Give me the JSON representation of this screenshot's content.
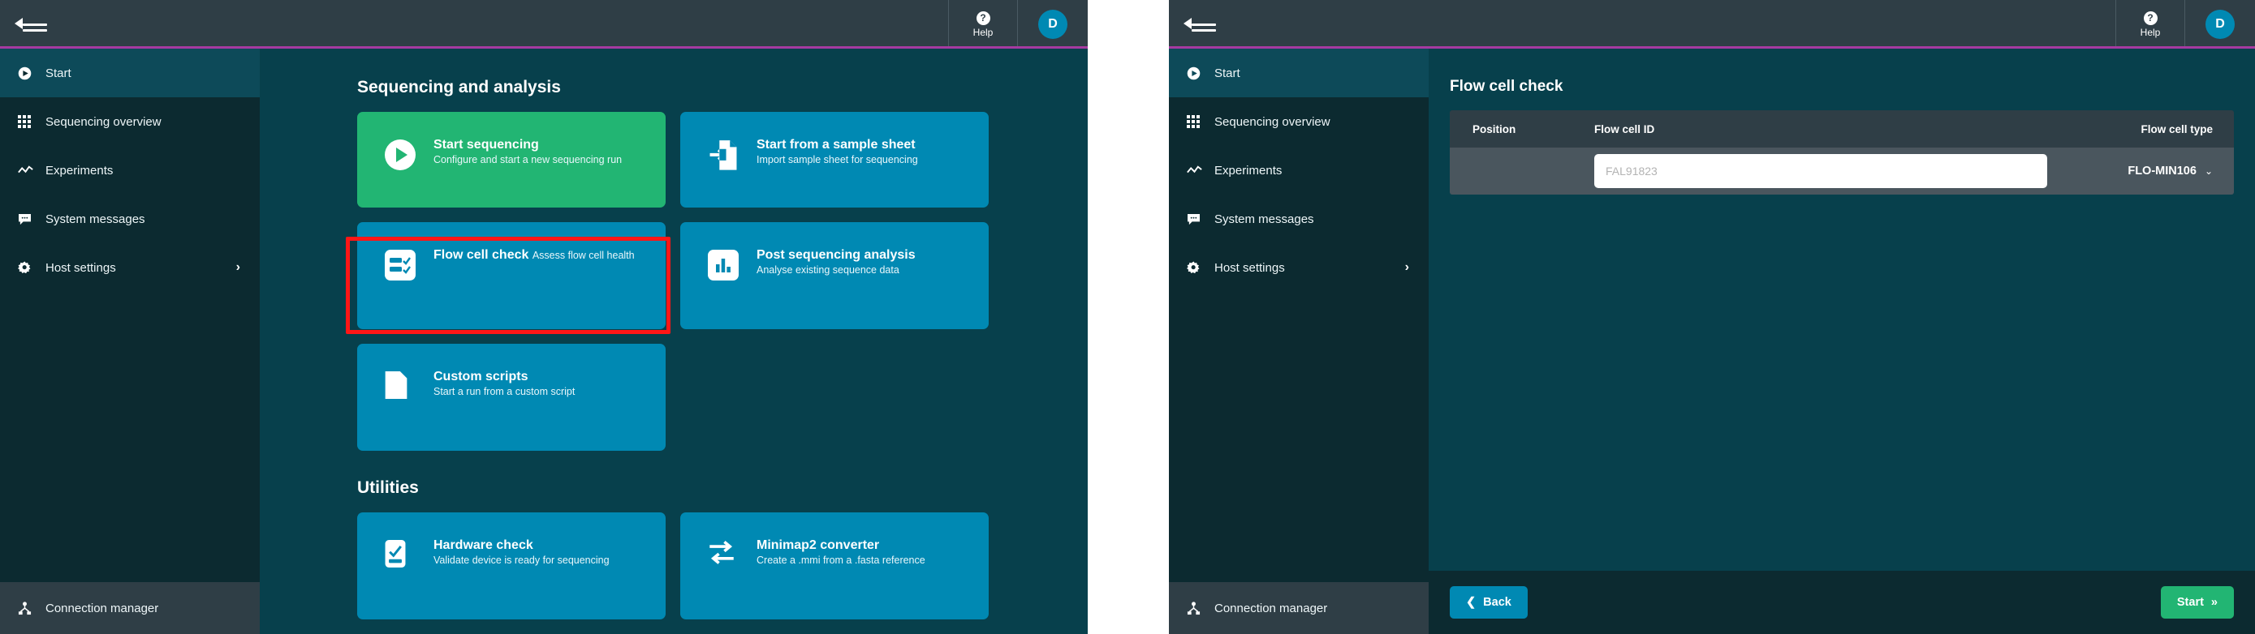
{
  "topbar": {
    "collapse_icon": "collapse-menu-icon",
    "help_label": "Help",
    "help_icon": "question-mark-icon",
    "avatar_initial": "D"
  },
  "sidebar": {
    "items": [
      {
        "label": "Start",
        "icon": "play-circle-icon",
        "active": true
      },
      {
        "label": "Sequencing overview",
        "icon": "grid-icon",
        "active": false
      },
      {
        "label": "Experiments",
        "icon": "line-chart-icon",
        "active": false
      },
      {
        "label": "System messages",
        "icon": "message-bubble-icon",
        "active": false
      },
      {
        "label": "Host settings",
        "icon": "gear-icon",
        "active": false,
        "chevron": "›"
      }
    ],
    "connection_manager": {
      "label": "Connection manager",
      "icon": "network-node-icon"
    }
  },
  "left_panel": {
    "sections": [
      {
        "title": "Sequencing and analysis",
        "tiles": [
          {
            "title": "Start sequencing",
            "sub": "Configure and start a new sequencing run",
            "icon": "play-icon",
            "color": "green"
          },
          {
            "title": "Start from a sample sheet",
            "sub": "Import sample sheet for sequencing",
            "icon": "file-import-icon",
            "color": "blue"
          },
          {
            "title": "Flow cell check",
            "sub": "Assess flow cell health",
            "icon": "checklist-icon",
            "color": "blue",
            "highlighted": true
          },
          {
            "title": "Post sequencing analysis",
            "sub": "Analyse existing sequence data",
            "icon": "bar-chart-icon",
            "color": "blue"
          },
          {
            "title": "Custom scripts",
            "sub": "Start a run from a custom script",
            "icon": "document-icon",
            "color": "blue"
          }
        ]
      },
      {
        "title": "Utilities",
        "tiles": [
          {
            "title": "Hardware check",
            "sub": "Validate device is ready for sequencing",
            "icon": "device-check-icon",
            "color": "blue"
          },
          {
            "title": "Minimap2 converter",
            "sub": "Create a .mmi from a .fasta reference",
            "icon": "convert-arrows-icon",
            "color": "blue"
          }
        ]
      }
    ]
  },
  "right_panel": {
    "page_title": "Flow cell check",
    "table": {
      "headers": {
        "position": "Position",
        "flow_cell_id": "Flow cell ID",
        "flow_cell_type": "Flow cell type"
      },
      "row": {
        "position": "",
        "flow_cell_id_value": "",
        "flow_cell_id_placeholder": "FAL91823",
        "flow_cell_type": "FLO-MIN106",
        "flow_cell_type_chevron": "⌄"
      }
    },
    "footer": {
      "back_label": "Back",
      "back_chevron": "❮",
      "start_label": "Start",
      "start_chevron": "»"
    }
  },
  "colors": {
    "accent_purple": "#a63aa1",
    "tile_blue": "#0089b3",
    "tile_green": "#22b573",
    "panel_bg": "#07404c",
    "sidebar_bg": "#0c2a30",
    "topbar_bg": "#2f3e46",
    "highlight_red": "#ff1616"
  }
}
